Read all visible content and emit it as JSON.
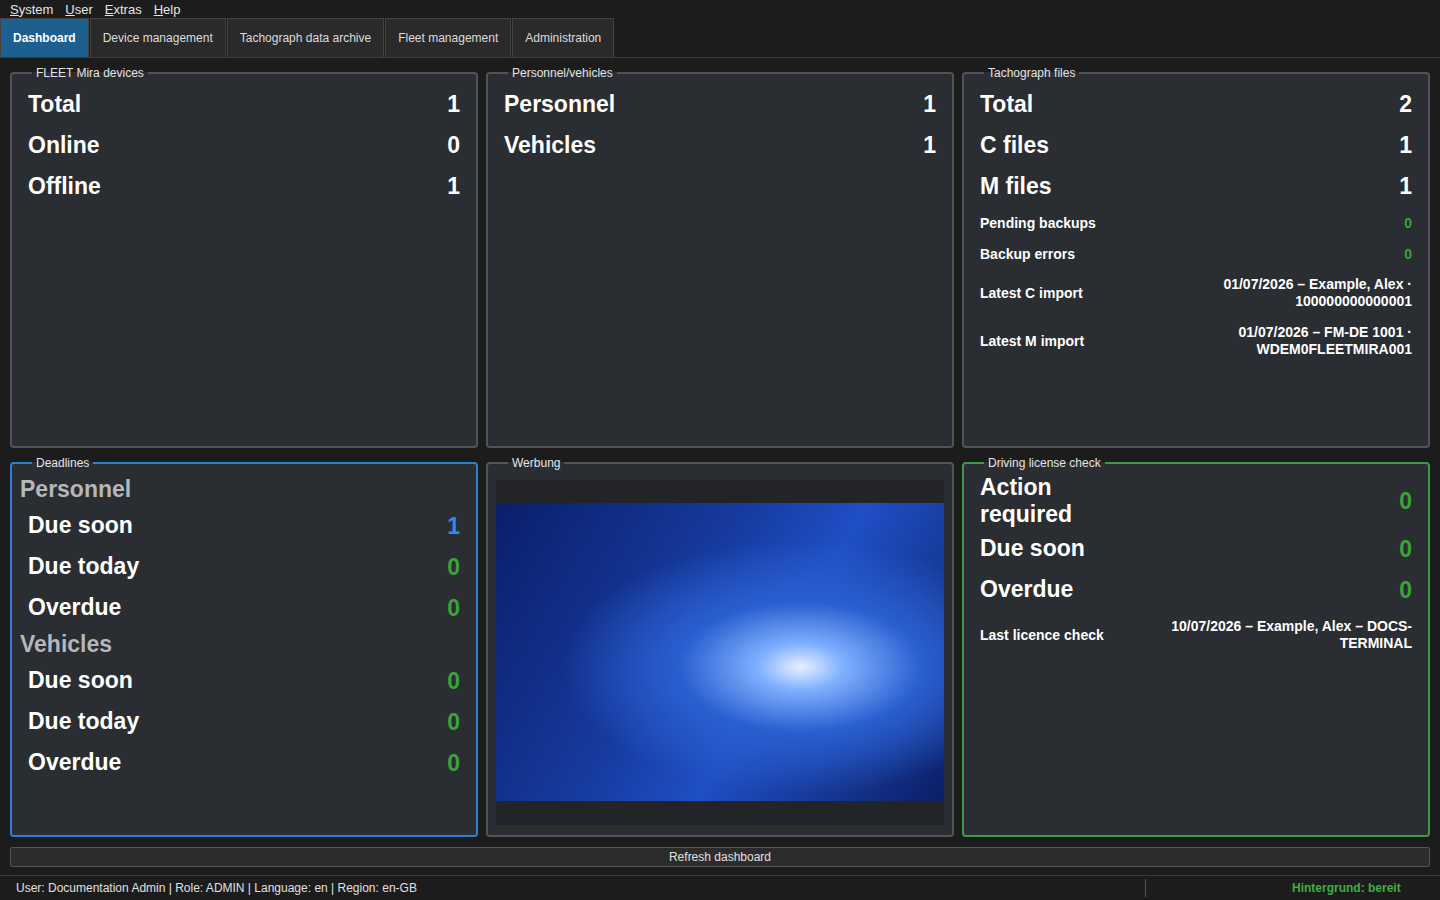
{
  "menu": [
    {
      "label": "System"
    },
    {
      "label": "User"
    },
    {
      "label": "Extras"
    },
    {
      "label": "Help"
    }
  ],
  "tabs": [
    {
      "label": "Dashboard",
      "selected": true
    },
    {
      "label": "Device management",
      "selected": false
    },
    {
      "label": "Tachograph data archive",
      "selected": false
    },
    {
      "label": "Fleet management",
      "selected": false
    },
    {
      "label": "Administration",
      "selected": false
    }
  ],
  "panels": [
    {
      "kind": "stats",
      "title": "FLEET Mira devices",
      "color": "#505357",
      "rows": [
        {
          "kind": "big",
          "label": "Total",
          "value": "1",
          "color": "#ffffff"
        },
        {
          "kind": "big",
          "label": "Online",
          "value": "0",
          "color": "#ffffff"
        },
        {
          "kind": "big",
          "label": "Offline",
          "value": "1",
          "color": "#ffffff"
        }
      ]
    },
    {
      "kind": "stats",
      "title": "Personnel/vehicles",
      "color": "#505357",
      "rows": [
        {
          "kind": "big",
          "label": "Personnel",
          "value": "1",
          "color": "#ffffff"
        },
        {
          "kind": "big",
          "label": "Vehicles",
          "value": "1",
          "color": "#ffffff"
        }
      ]
    },
    {
      "kind": "stats",
      "title": "Tachograph files",
      "color": "#505357",
      "rows": [
        {
          "kind": "big",
          "label": "Total",
          "value": "2",
          "color": "#ffffff"
        },
        {
          "kind": "big",
          "label": "C files",
          "value": "1",
          "color": "#ffffff"
        },
        {
          "kind": "big",
          "label": "M files",
          "value": "1",
          "color": "#ffffff"
        },
        {
          "kind": "small",
          "label": "Pending backups",
          "value": "0",
          "color": "#3aa33a"
        },
        {
          "kind": "small",
          "label": "Backup errors",
          "value": "0",
          "color": "#3aa33a"
        },
        {
          "kind": "detail",
          "label": "Latest C import",
          "value": "01/07/2026 – Example, Alex · 100000000000001",
          "color": "#ffffff"
        },
        {
          "kind": "detail",
          "label": "Latest M import",
          "value": "01/07/2026 – FM-DE 1001 · WDEM0FLEETMIRA001",
          "color": "#ffffff"
        }
      ]
    },
    {
      "kind": "stats",
      "title": "Deadlines",
      "color": "#2f7fd0",
      "rows": [
        {
          "kind": "heading",
          "label": "Personnel"
        },
        {
          "kind": "big",
          "label": "Due soon",
          "value": "1",
          "color": "#2f8fe0"
        },
        {
          "kind": "big",
          "label": "Due today",
          "value": "0",
          "color": "#3aa33a"
        },
        {
          "kind": "big",
          "label": "Overdue",
          "value": "0",
          "color": "#3aa33a"
        },
        {
          "kind": "heading",
          "label": "Vehicles"
        },
        {
          "kind": "big",
          "label": "Due soon",
          "value": "0",
          "color": "#3aa33a"
        },
        {
          "kind": "big",
          "label": "Due today",
          "value": "0",
          "color": "#3aa33a"
        },
        {
          "kind": "big",
          "label": "Overdue",
          "value": "0",
          "color": "#3aa33a"
        }
      ]
    },
    {
      "kind": "ad",
      "title": "Werbung",
      "color": "#505357"
    },
    {
      "kind": "stats",
      "title": "Driving license check",
      "color": "#3a9a4a",
      "rows": [
        {
          "kind": "big",
          "label": "Action required",
          "value": "0",
          "color": "#3aa33a"
        },
        {
          "kind": "big",
          "label": "Due soon",
          "value": "0",
          "color": "#3aa33a"
        },
        {
          "kind": "big",
          "label": "Overdue",
          "value": "0",
          "color": "#3aa33a"
        },
        {
          "kind": "detail",
          "label": "Last licence check",
          "value": "10/07/2026 – Example, Alex – DOCS-TERMINAL",
          "color": "#ffffff"
        }
      ]
    }
  ],
  "refresh": {
    "label": "Refresh dashboard"
  },
  "status_bar": {
    "left": "User: Documentation Admin | Role: ADMIN | Language: en | Region: en-GB",
    "right": "Hintergrund: bereit",
    "right_color": "#3fae3f"
  }
}
